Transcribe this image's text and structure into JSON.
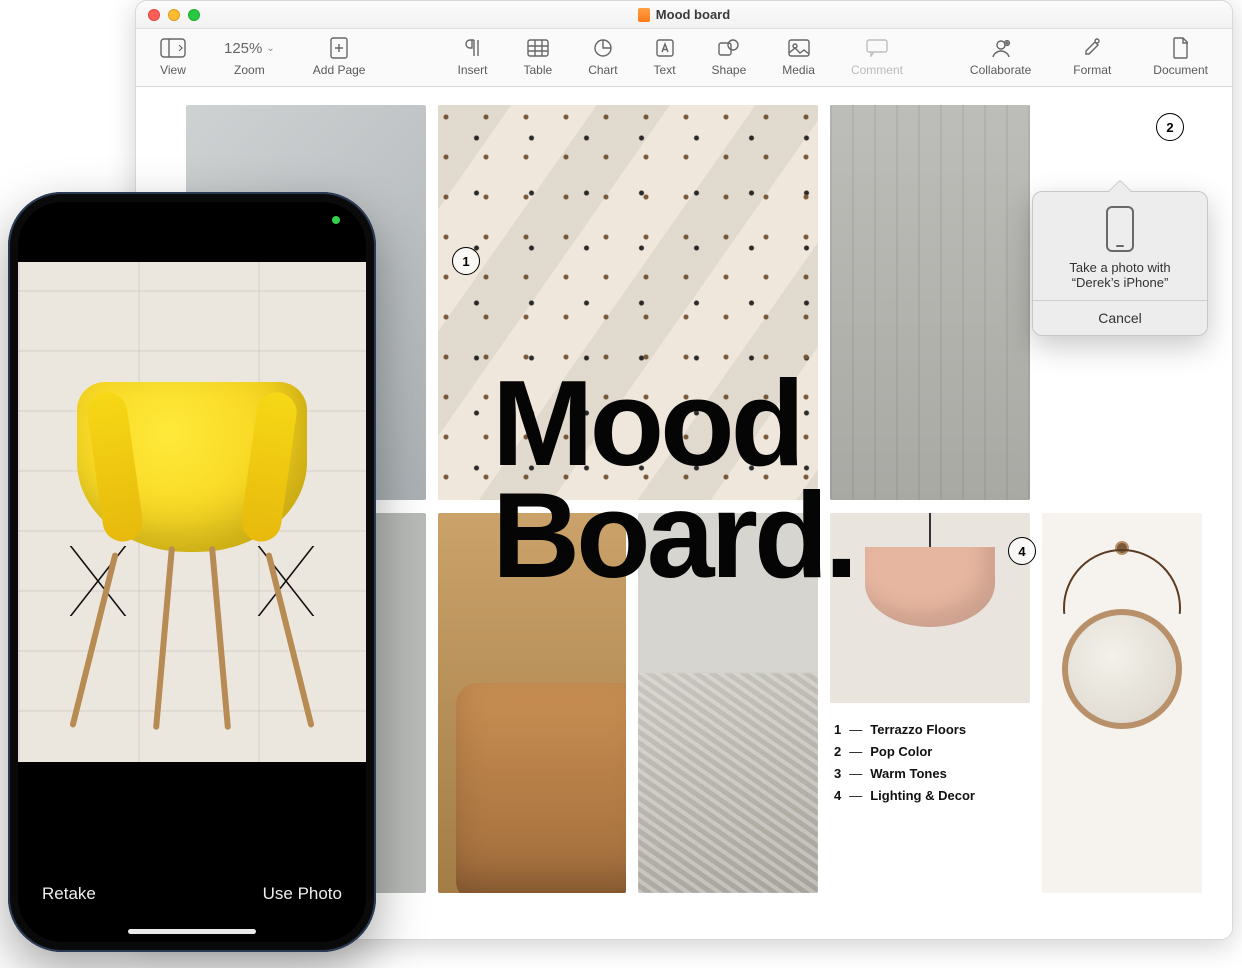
{
  "window": {
    "title": "Mood board"
  },
  "toolbar": {
    "view": "View",
    "zoom_value": "125%",
    "zoom_label": "Zoom",
    "add_page": "Add Page",
    "insert": "Insert",
    "table": "Table",
    "chart": "Chart",
    "text": "Text",
    "shape": "Shape",
    "media": "Media",
    "comment": "Comment",
    "collaborate": "Collaborate",
    "format": "Format",
    "document": "Document"
  },
  "document": {
    "headline_line1": "Mood",
    "headline_line2": "Board.",
    "callouts": {
      "n1": "1",
      "n2": "2",
      "n4": "4"
    },
    "legend": [
      {
        "num": "1",
        "label": "Terrazzo Floors"
      },
      {
        "num": "2",
        "label": "Pop Color"
      },
      {
        "num": "3",
        "label": "Warm Tones"
      },
      {
        "num": "4",
        "label": "Lighting & Decor"
      }
    ]
  },
  "popover": {
    "message_line1": "Take a photo with",
    "message_line2": "“Derek’s iPhone”",
    "cancel": "Cancel"
  },
  "iphone": {
    "retake": "Retake",
    "use_photo": "Use Photo"
  }
}
